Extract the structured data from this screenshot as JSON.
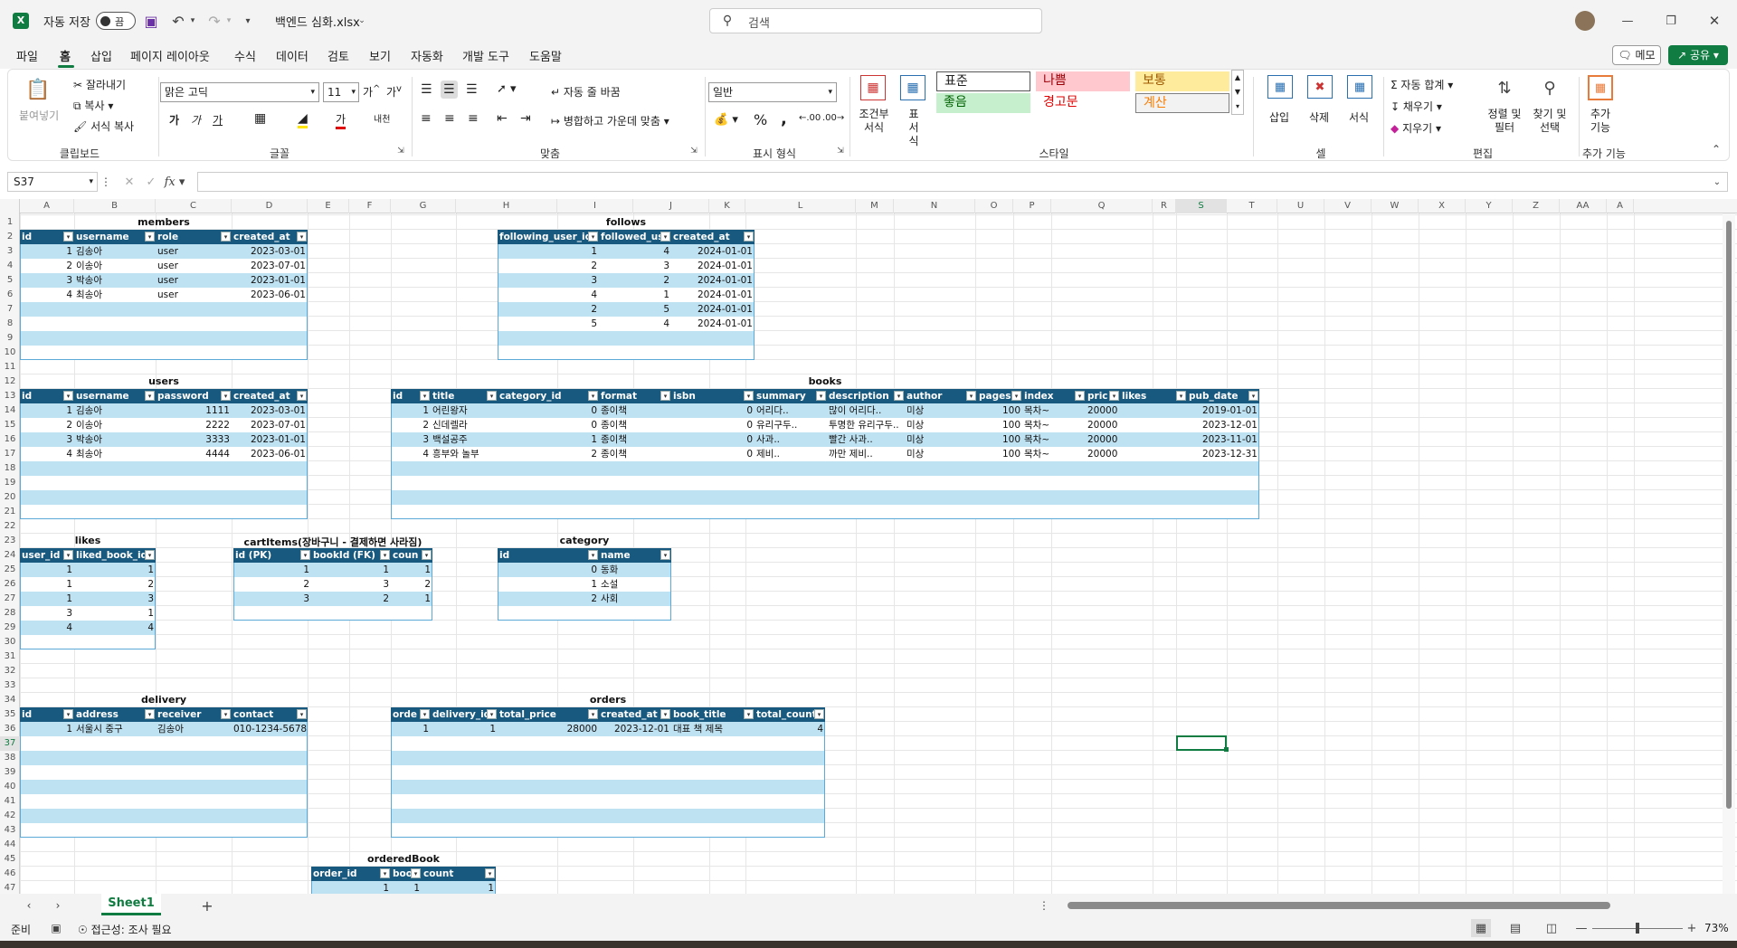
{
  "title": {
    "autosave": "자동 저장",
    "toggle": "끔",
    "filename": "백엔드 심화.xlsx",
    "search": "검색"
  },
  "menu": {
    "items": [
      "파일",
      "홈",
      "삽입",
      "페이지 레이아웃",
      "수식",
      "데이터",
      "검토",
      "보기",
      "자동화",
      "개발 도구",
      "도움말"
    ],
    "memo": "메모",
    "share": "공유"
  },
  "ribbon": {
    "paste": "붙여넣기",
    "cut": "잘라내기",
    "copy": "복사",
    "format_painter": "서식 복사",
    "g_clipboard": "클립보드",
    "font": "맑은 고딕",
    "size": "11",
    "g_font": "글꼴",
    "wrap": "자동 줄 바꿈",
    "merge": "병합하고 가운데 맞춤",
    "g_align": "맞춤",
    "numfmt": "일반",
    "g_number": "표시 형식",
    "cond": "조건부 서식",
    "tablefmt": "표 서식",
    "styles": [
      "표준",
      "나쁨",
      "보통",
      "좋음",
      "경고문",
      "계산"
    ],
    "g_styles": "스타일",
    "insert": "삽입",
    "delete": "삭제",
    "format": "서식",
    "g_cells": "셀",
    "autosum": "자동 합계",
    "fill": "채우기",
    "clear": "지우기",
    "sort": "정렬 및 필터",
    "find": "찾기 및 선택",
    "g_edit": "편집",
    "addins": "추가 기능",
    "g_addins": "추가 기능"
  },
  "namebox": "S37",
  "columns": [
    "A",
    "B",
    "C",
    "D",
    "E",
    "F",
    "G",
    "H",
    "I",
    "J",
    "K",
    "L",
    "M",
    "N",
    "O",
    "P",
    "Q",
    "R",
    "S",
    "T",
    "U",
    "V",
    "W",
    "X",
    "Y",
    "Z",
    "AA",
    "A"
  ],
  "tables": [
    {
      "title": "members",
      "headers": [
        "id",
        "username",
        "role",
        "created_at"
      ],
      "rows": [
        [
          "1",
          "김송아",
          "user",
          "2023-03-01"
        ],
        [
          "2",
          "이송아",
          "user",
          "2023-07-01"
        ],
        [
          "3",
          "박송아",
          "user",
          "2023-01-01"
        ],
        [
          "4",
          "최송아",
          "user",
          "2023-06-01"
        ]
      ]
    },
    {
      "title": "follows",
      "headers": [
        "following_user_id",
        "followed_us",
        "created_at"
      ],
      "rows": [
        [
          "1",
          "4",
          "2024-01-01"
        ],
        [
          "2",
          "3",
          "2024-01-01"
        ],
        [
          "3",
          "2",
          "2024-01-01"
        ],
        [
          "4",
          "1",
          "2024-01-01"
        ],
        [
          "2",
          "5",
          "2024-01-01"
        ],
        [
          "5",
          "4",
          "2024-01-01"
        ]
      ]
    },
    {
      "title": "users",
      "headers": [
        "id",
        "username",
        "password",
        "created_at"
      ],
      "rows": [
        [
          "1",
          "김송아",
          "1111",
          "2023-03-01"
        ],
        [
          "2",
          "이송아",
          "2222",
          "2023-07-01"
        ],
        [
          "3",
          "박송아",
          "3333",
          "2023-01-01"
        ],
        [
          "4",
          "최송아",
          "4444",
          "2023-06-01"
        ]
      ]
    },
    {
      "title": "books",
      "headers": [
        "id",
        "title",
        "category_id",
        "format",
        "isbn",
        "summary",
        "description",
        "author",
        "pages",
        "index",
        "pric",
        "likes",
        "pub_date"
      ],
      "rows": [
        [
          "1",
          "어린왕자",
          "0",
          "종이책",
          "0",
          "어리다..",
          "많이 어리다..",
          "미상",
          "100",
          "목차~",
          "20000",
          "",
          "2019-01-01"
        ],
        [
          "2",
          "신데렐라",
          "0",
          "종이책",
          "0",
          "유리구두..",
          "투명한 유리구두..",
          "미상",
          "100",
          "목차~",
          "20000",
          "",
          "2023-12-01"
        ],
        [
          "3",
          "백설공주",
          "1",
          "종이책",
          "0",
          "사과..",
          "빨간 사과..",
          "미상",
          "100",
          "목차~",
          "20000",
          "",
          "2023-11-01"
        ],
        [
          "4",
          "흥부와 놀부",
          "2",
          "종이책",
          "0",
          "제비..",
          "까만 제비..",
          "미상",
          "100",
          "목차~",
          "20000",
          "",
          "2023-12-31"
        ]
      ]
    },
    {
      "title": "likes",
      "headers": [
        "user_id",
        "liked_book_id"
      ],
      "rows": [
        [
          "1",
          "1"
        ],
        [
          "1",
          "2"
        ],
        [
          "1",
          "3"
        ],
        [
          "3",
          "1"
        ],
        [
          "4",
          "4"
        ]
      ]
    },
    {
      "title": "cartItems(장바구니 - 결제하면 사라짐)",
      "headers": [
        "id (PK)",
        "bookId (FK)",
        "coun"
      ],
      "rows": [
        [
          "1",
          "1",
          "1"
        ],
        [
          "2",
          "3",
          "2"
        ],
        [
          "3",
          "2",
          "1"
        ]
      ]
    },
    {
      "title": "category",
      "headers": [
        "id",
        "name"
      ],
      "rows": [
        [
          "0",
          "동화"
        ],
        [
          "1",
          "소설"
        ],
        [
          "2",
          "사회"
        ]
      ]
    },
    {
      "title": "delivery",
      "headers": [
        "id",
        "address",
        "receiver",
        "contact"
      ],
      "rows": [
        [
          "1",
          "서울시 중구",
          "김송아",
          "010-1234-5678"
        ]
      ]
    },
    {
      "title": "orders",
      "headers": [
        "orde",
        "delivery_id",
        "total_price",
        "created_at",
        "book_title",
        "total_count"
      ],
      "rows": [
        [
          "1",
          "1",
          "28000",
          "2023-12-01",
          "대표 책 제목",
          "4"
        ]
      ]
    },
    {
      "title": "orderedBook",
      "headers": [
        "order_id",
        "book",
        "count"
      ],
      "rows": [
        [
          "1",
          "1",
          "1"
        ]
      ]
    }
  ],
  "sheet": {
    "tab": "Sheet1"
  },
  "status": {
    "ready": "준비",
    "access": "접근성: 조사 필요",
    "zoom": "73%"
  }
}
